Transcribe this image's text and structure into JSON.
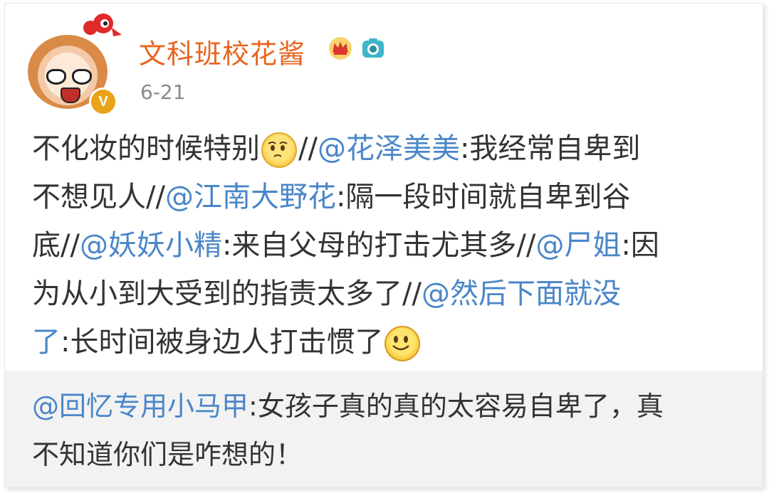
{
  "post": {
    "username": "文科班校花酱",
    "date": "6-21",
    "lines": [
      [
        {
          "t": "不化妆的时候特别"
        },
        {
          "emoji": "sad-face-icon"
        },
        {
          "t": "//"
        },
        {
          "t": "@花泽美美",
          "m": true
        },
        {
          "t": ":我经常自卑到"
        }
      ],
      [
        {
          "t": "不想见人//"
        },
        {
          "t": "@江南大野花",
          "m": true
        },
        {
          "t": ":隔一段时间就自卑到谷"
        }
      ],
      [
        {
          "t": "底//"
        },
        {
          "t": "@妖妖小精",
          "m": true
        },
        {
          "t": ":来自父母的打击尤其多//"
        },
        {
          "t": "@尸姐",
          "m": true
        },
        {
          "t": ":因"
        }
      ],
      [
        {
          "t": "为从小到大受到的指责太多了//"
        },
        {
          "t": "@然后下面就没",
          "m": true
        }
      ],
      [
        {
          "t": "了",
          "m": true
        },
        {
          "t": ":长时间被身边人打击惯了"
        },
        {
          "emoji": "smile-face-icon"
        }
      ]
    ]
  },
  "retweet": {
    "lines": [
      [
        {
          "t": "@回忆专用小马甲",
          "m": true
        },
        {
          "t": ":女孩子真的真的太容易自卑了，真"
        }
      ],
      [
        {
          "t": "不知道你们是咋想的！"
        }
      ]
    ]
  },
  "colors": {
    "username": "#e8641f",
    "mention": "#4a86c8",
    "text": "#333333",
    "retweet_bg": "#f2f2f2"
  }
}
